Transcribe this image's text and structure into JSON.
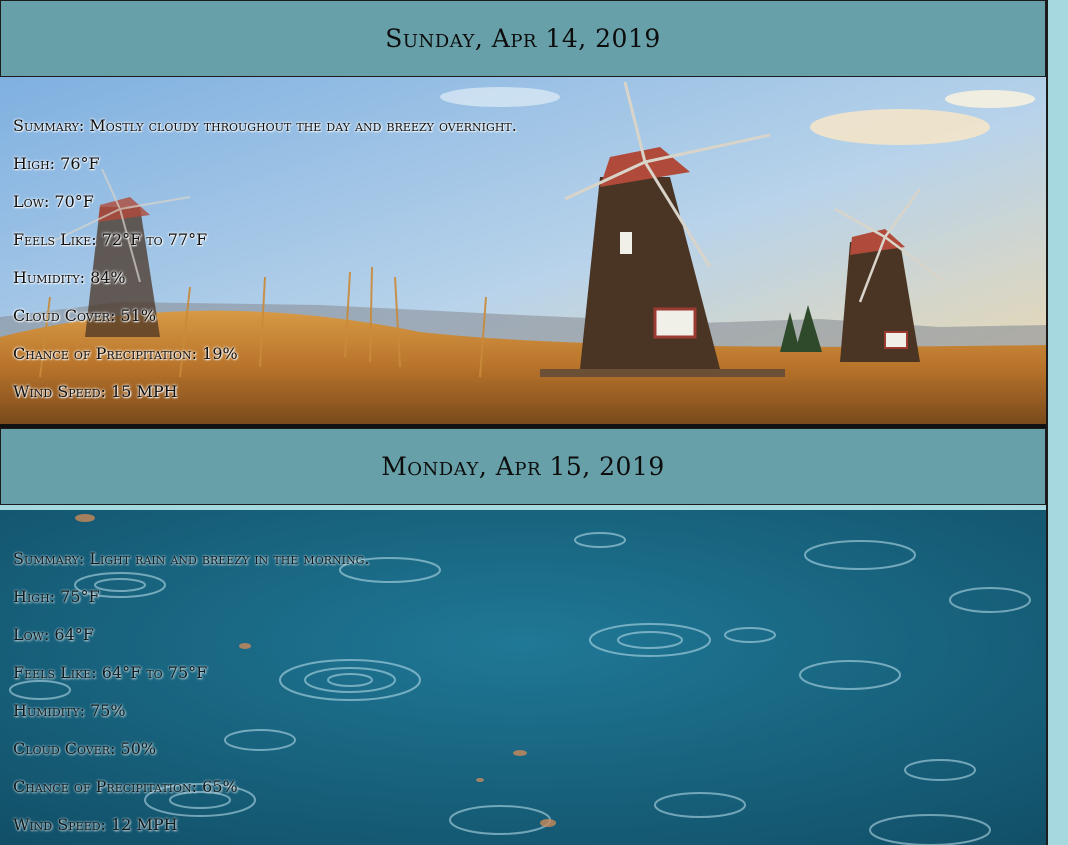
{
  "days": [
    {
      "date": "Sunday, Apr 14, 2019",
      "background": "windmills-field-photo",
      "summary": "Summary: Mostly cloudy throughout the day and breezy overnight.",
      "high": "High: 76°F",
      "low": "Low: 70°F",
      "feels_like": "Feels Like: 72°F to 77°F",
      "humidity": "Humidity: 84%",
      "cloud_cover": "Cloud Cover: 51%",
      "precipitation": "Chance of Precipitation: 19%",
      "wind_speed": "Wind Speed: 15 MPH"
    },
    {
      "date": "Monday, Apr 15, 2019",
      "background": "rain-puddle-photo",
      "summary": "Summary: Light rain and breezy in the morning.",
      "high": "High: 75°F",
      "low": "Low: 64°F",
      "feels_like": "Feels Like: 64°F to 75°F",
      "humidity": "Humidity: 75%",
      "cloud_cover": "Cloud Cover: 50%",
      "precipitation": "Chance of Precipitation: 65%",
      "wind_speed": "Wind Speed: 12 MPH"
    }
  ],
  "colors": {
    "header_bg": "#67a0a8",
    "page_bg": "#a6d9df",
    "rain_water": "#1b6a85"
  }
}
